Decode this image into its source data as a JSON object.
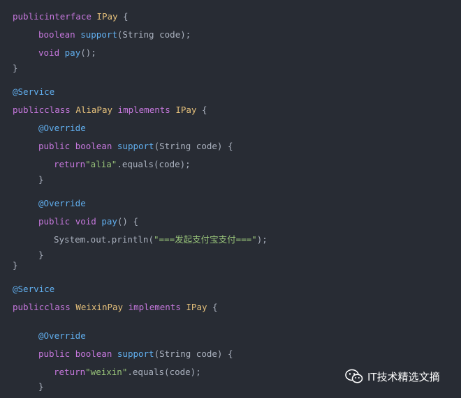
{
  "code": {
    "lines": [
      {
        "tokens": [
          {
            "t": "public",
            "c": "kw"
          },
          {
            "t": "interface",
            "c": "kw"
          },
          {
            "t": " ",
            "c": "pl"
          },
          {
            "t": "IPay",
            "c": "ty"
          },
          {
            "t": " {",
            "c": "pl"
          }
        ]
      },
      {
        "tokens": [
          {
            "t": "boolean",
            "c": "kw"
          },
          {
            "t": " ",
            "c": "pl"
          },
          {
            "t": "support",
            "c": "fn"
          },
          {
            "t": "(String code);",
            "c": "pl"
          }
        ]
      },
      {
        "tokens": [
          {
            "t": "void",
            "c": "kw"
          },
          {
            "t": " ",
            "c": "pl"
          },
          {
            "t": "pay",
            "c": "fn"
          },
          {
            "t": "();",
            "c": "pl"
          }
        ]
      },
      {
        "tokens": [
          {
            "t": "}",
            "c": "pl"
          }
        ]
      },
      {
        "tokens": [
          {
            "t": "@Service",
            "c": "an"
          }
        ]
      },
      {
        "tokens": [
          {
            "t": "public",
            "c": "kw"
          },
          {
            "t": "class",
            "c": "kw"
          },
          {
            "t": " ",
            "c": "pl"
          },
          {
            "t": "AliaPay",
            "c": "ty"
          },
          {
            "t": " ",
            "c": "pl"
          },
          {
            "t": "implements",
            "c": "kw"
          },
          {
            "t": " ",
            "c": "pl"
          },
          {
            "t": "IPay",
            "c": "ty"
          },
          {
            "t": " {",
            "c": "pl"
          }
        ]
      },
      {
        "tokens": [
          {
            "t": "@Override",
            "c": "an"
          }
        ]
      },
      {
        "tokens": [
          {
            "t": "public",
            "c": "kw"
          },
          {
            "t": " ",
            "c": "pl"
          },
          {
            "t": "boolean",
            "c": "kw"
          },
          {
            "t": " ",
            "c": "pl"
          },
          {
            "t": "support",
            "c": "fn"
          },
          {
            "t": "(String code) {",
            "c": "pl"
          }
        ]
      },
      {
        "tokens": [
          {
            "t": "return",
            "c": "kw"
          },
          {
            "t": "\"alia\"",
            "c": "str"
          },
          {
            "t": ".equals(code);",
            "c": "pl"
          }
        ]
      },
      {
        "tokens": [
          {
            "t": "}",
            "c": "pl"
          }
        ]
      },
      {
        "tokens": [
          {
            "t": "@Override",
            "c": "an"
          }
        ]
      },
      {
        "tokens": [
          {
            "t": "public",
            "c": "kw"
          },
          {
            "t": " ",
            "c": "pl"
          },
          {
            "t": "void",
            "c": "kw"
          },
          {
            "t": " ",
            "c": "pl"
          },
          {
            "t": "pay",
            "c": "fn"
          },
          {
            "t": "() {",
            "c": "pl"
          }
        ]
      },
      {
        "tokens": [
          {
            "t": "System.out.println(",
            "c": "pl"
          },
          {
            "t": "\"===发起支付宝支付===\"",
            "c": "str"
          },
          {
            "t": ");",
            "c": "pl"
          }
        ]
      },
      {
        "tokens": [
          {
            "t": "}",
            "c": "pl"
          }
        ]
      },
      {
        "tokens": [
          {
            "t": "}",
            "c": "pl"
          }
        ]
      },
      {
        "tokens": [
          {
            "t": "@Service",
            "c": "an"
          }
        ]
      },
      {
        "tokens": [
          {
            "t": "public",
            "c": "kw"
          },
          {
            "t": "class",
            "c": "kw"
          },
          {
            "t": " ",
            "c": "pl"
          },
          {
            "t": "WeixinPay",
            "c": "ty"
          },
          {
            "t": " ",
            "c": "pl"
          },
          {
            "t": "implements",
            "c": "kw"
          },
          {
            "t": " ",
            "c": "pl"
          },
          {
            "t": "IPay",
            "c": "ty"
          },
          {
            "t": " {",
            "c": "pl"
          }
        ]
      },
      {
        "tokens": [
          {
            "t": "@Override",
            "c": "an"
          }
        ]
      },
      {
        "tokens": [
          {
            "t": "public",
            "c": "kw"
          },
          {
            "t": " ",
            "c": "pl"
          },
          {
            "t": "boolean",
            "c": "kw"
          },
          {
            "t": " ",
            "c": "pl"
          },
          {
            "t": "support",
            "c": "fn"
          },
          {
            "t": "(String code) {",
            "c": "pl"
          }
        ]
      },
      {
        "tokens": [
          {
            "t": "return",
            "c": "kw"
          },
          {
            "t": "\"weixin\"",
            "c": "str"
          },
          {
            "t": ".equals(code);",
            "c": "pl"
          }
        ]
      },
      {
        "tokens": [
          {
            "t": "}",
            "c": "pl"
          }
        ]
      }
    ]
  },
  "watermark": {
    "text": "IT技术精选文摘",
    "icon": "wechat-icon"
  },
  "colors": {
    "background": "#282c34",
    "keyword": "#c678dd",
    "type": "#e5c07b",
    "function": "#61afef",
    "annotation": "#61afef",
    "string": "#98c379",
    "plain": "#abb2bf"
  }
}
